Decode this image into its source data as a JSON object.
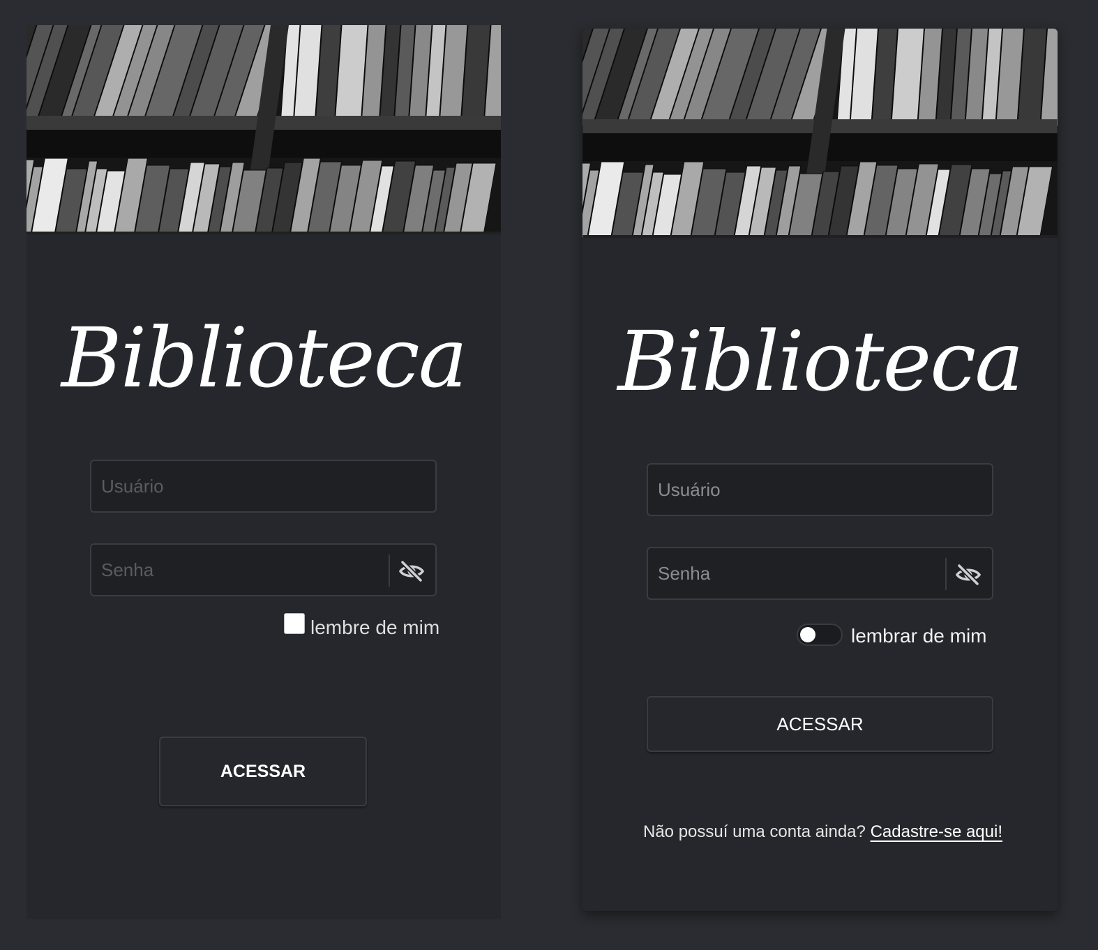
{
  "left": {
    "title": "Biblioteca",
    "username_placeholder": "Usuário",
    "password_placeholder": "Senha",
    "remember_label": "lembre de mim",
    "remember_checked": false,
    "submit_label": "ACESSAR"
  },
  "right": {
    "title": "Biblioteca",
    "username_placeholder": "Usuário",
    "password_placeholder": "Senha",
    "remember_label": "lembrar de mim",
    "remember_on": false,
    "submit_label": "ACESSAR",
    "signup_prompt": "Não possuí uma conta ainda?",
    "signup_link": "Cadastre-se aqui!"
  },
  "icons": {
    "hero": "bookshelf-photo",
    "password_toggle": "eye-slash-icon"
  },
  "colors": {
    "page_bg": "#2b2c31",
    "card_bg": "#26272c",
    "field_bg": "#1f2024",
    "border": "#3b3c42",
    "text": "#ffffff"
  }
}
